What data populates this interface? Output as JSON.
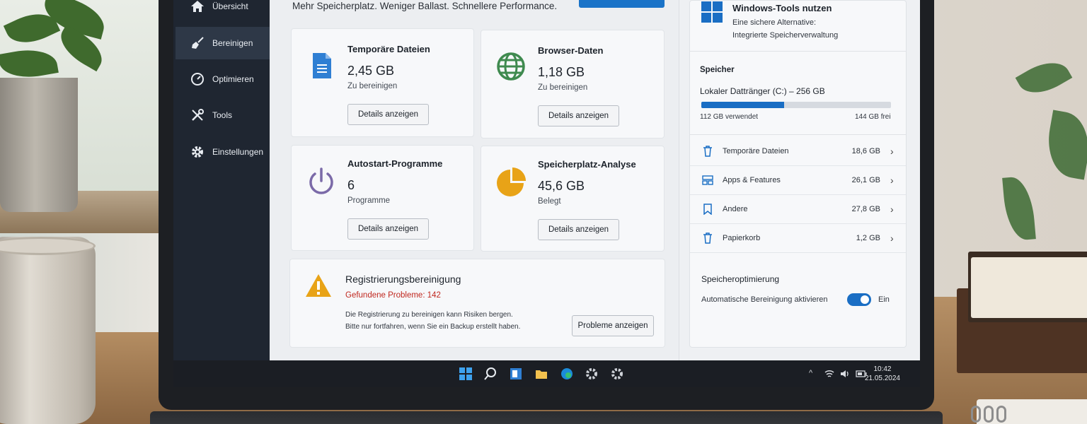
{
  "sidebar": {
    "items": [
      {
        "label": "Übersicht",
        "icon": "home-icon"
      },
      {
        "label": "Bereinigen",
        "icon": "broom-icon",
        "active": true
      },
      {
        "label": "Optimieren",
        "icon": "speedometer-icon"
      },
      {
        "label": "Tools",
        "icon": "tools-icon"
      },
      {
        "label": "Einstellungen",
        "icon": "gear-icon"
      }
    ]
  },
  "main": {
    "tagline": "Mehr Speicherplatz. Weniger Ballast. Schnellere Performance.",
    "cards": [
      {
        "title": "Temporäre Dateien",
        "value": "2,45 GB",
        "sub": "Zu bereinigen",
        "button": "Details anzeigen",
        "icon": "document-icon"
      },
      {
        "title": "Browser-Daten",
        "value": "1,18 GB",
        "sub": "Zu bereinigen",
        "button": "Details anzeigen",
        "icon": "globe-icon"
      },
      {
        "title": "Autostart-Programme",
        "value": "6",
        "sub": "Programme",
        "button": "Details anzeigen",
        "icon": "power-icon"
      },
      {
        "title": "Speicherplatz-Analyse",
        "value": "45,6 GB",
        "sub": "Belegt",
        "button": "Details anzeigen",
        "icon": "pie-chart-icon"
      }
    ],
    "registry": {
      "title": "Registrierungsbereinigung",
      "problems": "Gefundene Probleme: 142",
      "warning_line1": "Die Registrierung zu bereinigen kann Risiken bergen.",
      "warning_line2": "Bitte nur fortfahren, wenn Sie ein Backup erstellt haben.",
      "button": "Probleme anzeigen",
      "icon": "warning-icon"
    }
  },
  "right_panel": {
    "windows_tools": {
      "title": "Windows-Tools nutzen",
      "line1": "Eine sichere Alternative:",
      "line2": "Integrierte Speicherverwaltung"
    },
    "storage": {
      "heading": "Speicher",
      "drive": "Lokaler Dattränger (C:) – 256 GB",
      "used": "112 GB verwendet",
      "free": "144 GB frei",
      "used_fraction": 0.4375,
      "rows": [
        {
          "label": "Temporäre Dateien",
          "size": "18,6 GB",
          "icon": "trash-icon"
        },
        {
          "label": "Apps & Features",
          "size": "26,1 GB",
          "icon": "apps-icon"
        },
        {
          "label": "Andere",
          "size": "27,8 GB",
          "icon": "bookmark-icon"
        },
        {
          "label": "Papierkorb",
          "size": "1,2 GB",
          "icon": "trash-icon"
        }
      ]
    },
    "optimization": {
      "heading": "Speicheroptimierung",
      "toggle_label": "Automatische Bereinigung aktivieren",
      "toggle_state": "Ein",
      "enabled": true
    }
  },
  "taskbar": {
    "time": "10:42",
    "date": "21.05.2024"
  },
  "colors": {
    "accent": "#1a6ec4",
    "sidebar_bg": "#1f2631",
    "warning": "#e8a317",
    "problem_text": "#c0281f"
  }
}
